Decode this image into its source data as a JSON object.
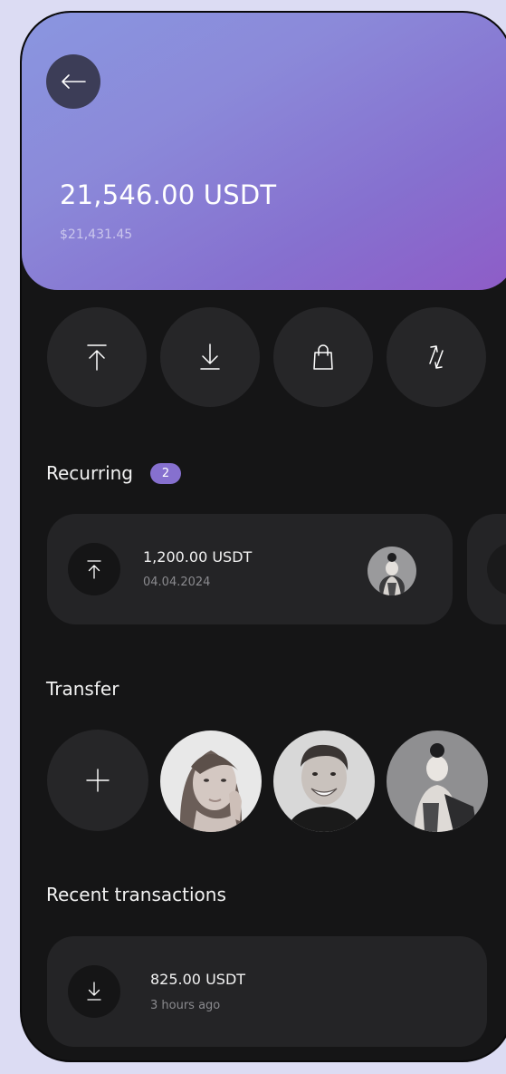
{
  "wallet": {
    "balance": "21,546.00 USDT",
    "balance_fiat": "$21,431.45"
  },
  "actions": [
    {
      "name": "send",
      "icon": "arrow-up-to-line-icon"
    },
    {
      "name": "receive",
      "icon": "arrow-down-to-line-icon"
    },
    {
      "name": "buy",
      "icon": "shopping-bag-icon"
    },
    {
      "name": "swap",
      "icon": "swap-arrows-icon"
    }
  ],
  "recurring": {
    "title": "Recurring",
    "count": "2",
    "items": [
      {
        "amount": "1,200.00 USDT",
        "date": "04.04.2024",
        "icon": "arrow-up-to-line-icon"
      }
    ]
  },
  "transfer": {
    "title": "Transfer",
    "add_icon": "plus-icon"
  },
  "recent": {
    "title": "Recent transactions",
    "items": [
      {
        "amount": "825.00 USDT",
        "time": "3 hours ago",
        "icon": "arrow-down-to-line-icon"
      }
    ]
  },
  "colors": {
    "accent": "#8670cf",
    "background": "#151516",
    "card": "#242426"
  }
}
